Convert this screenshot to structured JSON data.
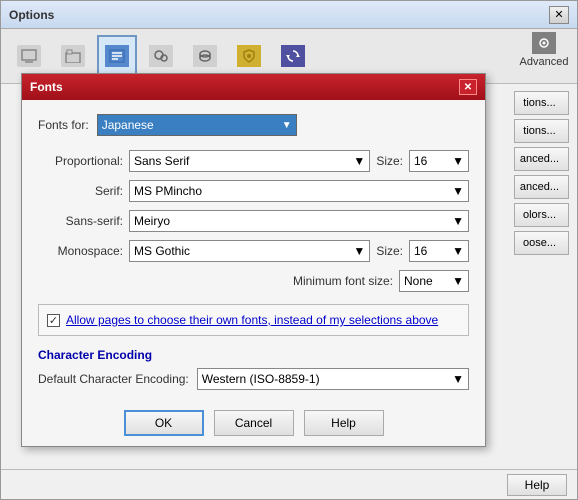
{
  "options_window": {
    "title": "Options",
    "close_btn": "✕"
  },
  "toolbar": {
    "buttons": [
      {
        "id": "general",
        "label": "",
        "icon": "general-icon"
      },
      {
        "id": "tabs",
        "label": "",
        "icon": "tabs-icon"
      },
      {
        "id": "content",
        "label": "",
        "icon": "content-icon",
        "active": true
      },
      {
        "id": "apps",
        "label": "",
        "icon": "apps-icon"
      },
      {
        "id": "privacy",
        "label": "",
        "icon": "privacy-icon"
      },
      {
        "id": "security",
        "label": "",
        "icon": "security-icon"
      },
      {
        "id": "sync",
        "label": "",
        "icon": "sync-icon"
      },
      {
        "id": "advanced",
        "label": "Advanced",
        "icon": "advanced-icon"
      }
    ]
  },
  "fonts_dialog": {
    "title": "Fonts",
    "close_btn": "✕",
    "fonts_for_label": "Fonts for:",
    "fonts_for_value": "Japanese",
    "rows": [
      {
        "label": "Proportional:",
        "value": "Sans Serif",
        "has_size": true,
        "size": "16"
      },
      {
        "label": "Serif:",
        "value": "MS PMincho",
        "has_size": false
      },
      {
        "label": "Sans-serif:",
        "value": "Meiryo",
        "has_size": false
      },
      {
        "label": "Monospace:",
        "value": "MS Gothic",
        "has_size": true,
        "size": "16"
      }
    ],
    "min_font_label": "Minimum font size:",
    "min_font_value": "None",
    "checkbox_text": "Allow pages to choose their own fonts, instead of my selections above",
    "encoding_section": "Character Encoding",
    "encoding_label": "Default Character Encoding:",
    "encoding_value": "Western (ISO-8859-1)",
    "ok_btn": "OK",
    "cancel_btn": "Cancel",
    "help_btn": "Help"
  },
  "right_buttons": [
    {
      "label": "tions..."
    },
    {
      "label": "tions..."
    },
    {
      "label": "anced..."
    },
    {
      "label": "anced..."
    },
    {
      "label": "olors..."
    },
    {
      "label": "oose..."
    }
  ],
  "bottom_help": "Help"
}
